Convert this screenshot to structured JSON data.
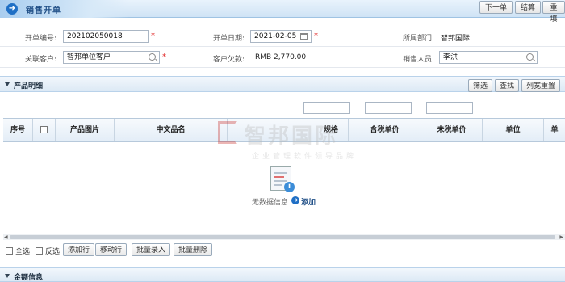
{
  "header": {
    "title": "销售开单",
    "buttons": [
      "下一单",
      "结算",
      "重填"
    ]
  },
  "form": {
    "order_no_label": "开单编号:",
    "order_no_value": "202102050018",
    "order_date_label": "开单日期:",
    "order_date_value": "2021-02-05",
    "dept_label": "所属部门:",
    "dept_value": "智邦国际",
    "customer_label": "关联客户:",
    "customer_value": "智邦单位客户",
    "arrears_label": "客户欠款:",
    "arrears_value": "RMB 2,770.00",
    "sales_label": "销售人员:",
    "sales_value": "李洪",
    "required_mark": "*"
  },
  "products": {
    "section_title": "产品明细",
    "toolbar": [
      "筛选",
      "查找",
      "列宽重置"
    ],
    "columns": [
      "序号",
      "产品图片",
      "中文品名",
      "规格",
      "含税单价",
      "未税单价",
      "单位",
      "单"
    ],
    "empty_text": "无数据信息",
    "add_label": "添加",
    "select_all_label": "全选",
    "invert_label": "反选",
    "footer_buttons": [
      "添加行",
      "移动行",
      "批量录入",
      "批量删除"
    ]
  },
  "watermark": {
    "main": "智邦国际",
    "sub": "企业管理软件领导品牌"
  },
  "amount_section": {
    "title": "金额信息"
  },
  "colors": {
    "accent": "#1f6fc5",
    "required": "#e02020",
    "section_bg": "#dce9f5"
  },
  "icons": [
    "arrow-right-icon",
    "search-icon",
    "calendar-icon",
    "collapse-triangle-icon",
    "document-info-icon",
    "add-circle-icon"
  ]
}
